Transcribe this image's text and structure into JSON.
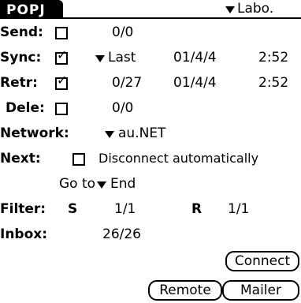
{
  "header": {
    "app_title": "POPJ",
    "account_selector": {
      "value": "Labo.",
      "icon": "triangle-down"
    }
  },
  "rows": {
    "send": {
      "label": "Send:",
      "checked": false,
      "count": "0/0"
    },
    "sync": {
      "label": "Sync:",
      "checked": true,
      "mode": "Last",
      "date": "01/4/4",
      "time": "2:52"
    },
    "retr": {
      "label": "Retr:",
      "checked": true,
      "count": "0/27",
      "date": "01/4/4",
      "time": "2:52"
    },
    "dele": {
      "label": "Dele:",
      "checked": false,
      "count": "0/0"
    }
  },
  "network": {
    "label": "Network:",
    "value": "au.NET"
  },
  "next": {
    "label": "Next:",
    "disconnect_checked": false,
    "disconnect_label": "Disconnect automatically",
    "goto_label": "Go to",
    "goto_value": "End"
  },
  "filter": {
    "label": "Filter:",
    "s_label": "S",
    "s_value": "1/1",
    "r_label": "R",
    "r_value": "1/1"
  },
  "inbox": {
    "label": "Inbox:",
    "value": "26/26"
  },
  "buttons": {
    "connect": "Connect",
    "remote": "Remote",
    "mailer": "Mailer"
  },
  "icons": {
    "check": "✓",
    "dropdown": "triangle-down"
  }
}
